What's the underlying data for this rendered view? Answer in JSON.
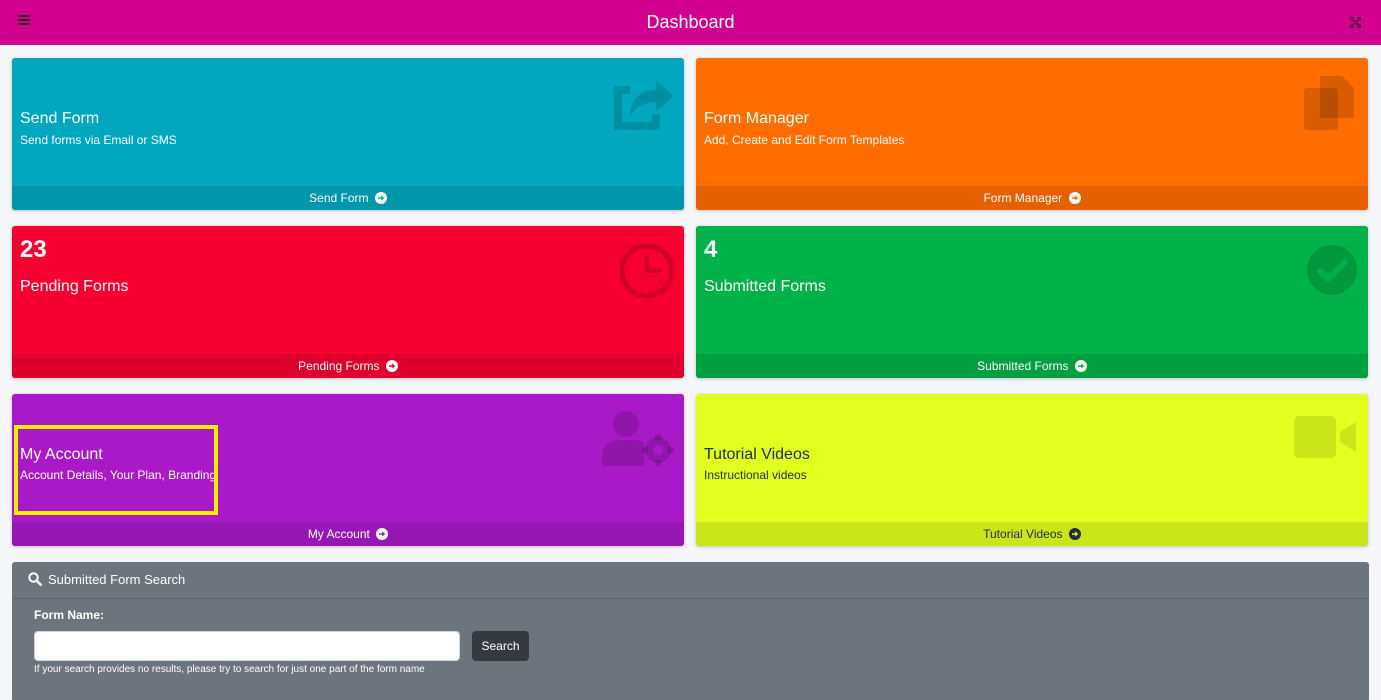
{
  "header": {
    "title": "Dashboard",
    "menu_icon": "hamburger-icon",
    "expand_icon": "fullscreen-icon",
    "color": "#d1008f"
  },
  "cards": {
    "send_form": {
      "title": "Send Form",
      "subtitle": "Send forms via Email or SMS",
      "footer": "Send Form",
      "icon": "share-icon",
      "color": "#00a7bf"
    },
    "form_manager": {
      "title": "Form Manager",
      "subtitle": "Add, Create and Edit Form Templates",
      "footer": "Form Manager",
      "icon": "copy-icon",
      "color": "#ff6d00"
    },
    "pending": {
      "count": "23",
      "title": "Pending Forms",
      "footer": "Pending Forms",
      "icon": "clock-icon",
      "color": "#f60031"
    },
    "submitted": {
      "count": "4",
      "title": "Submitted Forms",
      "footer": "Submitted Forms",
      "icon": "check-circle-icon",
      "color": "#00b248"
    },
    "my_account": {
      "title": "My Account",
      "subtitle": "Account Details, Your Plan, Branding",
      "footer": "My Account",
      "icon": "user-cog-icon",
      "color": "#aa19c8"
    },
    "tutorials": {
      "title": "Tutorial Videos",
      "subtitle": "Instructional videos",
      "footer": "Tutorial Videos",
      "icon": "video-icon",
      "color": "#e3ff1f"
    }
  },
  "search": {
    "title": "Submitted Form Search",
    "label": "Form Name:",
    "value": "",
    "placeholder": "",
    "button": "Search",
    "help": "If your search provides no results, please try to search for just one part of the form name"
  }
}
